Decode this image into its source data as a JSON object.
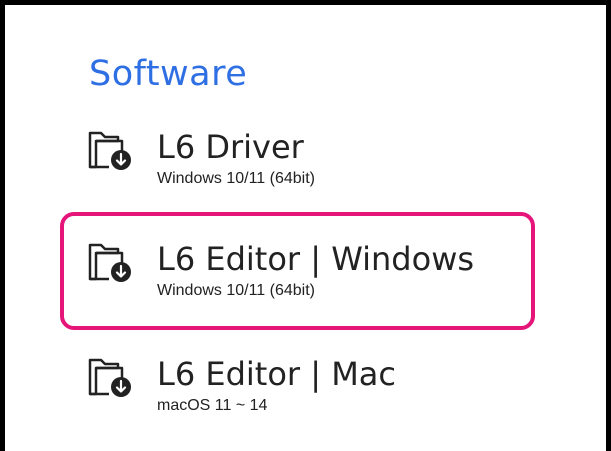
{
  "section": {
    "title": "Software"
  },
  "items": [
    {
      "name": "L6 Driver",
      "requirement": "Windows 10/11 (64bit)",
      "icon": "folder-download-icon"
    },
    {
      "name": "L6 Editor | Windows",
      "requirement": "Windows 10/11 (64bit)",
      "icon": "folder-download-icon",
      "highlighted": true
    },
    {
      "name": "L6 Editor | Mac",
      "requirement": "macOS 11 ~ 14",
      "icon": "folder-download-icon"
    }
  ],
  "colors": {
    "title": "#2f6fe4",
    "highlight": "#e5157a",
    "text": "#222222"
  }
}
